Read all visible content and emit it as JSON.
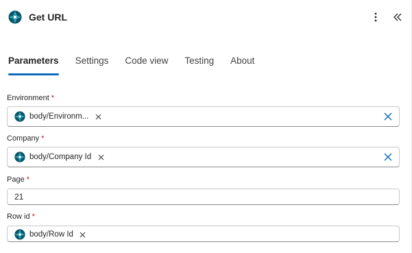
{
  "header": {
    "title": "Get URL",
    "logo_icon": "dataverse-logo-icon",
    "more_icon": "more-vertical-icon",
    "collapse_icon": "double-chevron-left-icon"
  },
  "tabs": [
    {
      "label": "Parameters",
      "active": true
    },
    {
      "label": "Settings",
      "active": false
    },
    {
      "label": "Code view",
      "active": false
    },
    {
      "label": "Testing",
      "active": false
    },
    {
      "label": "About",
      "active": false
    }
  ],
  "fields": {
    "environment": {
      "label": "Environment",
      "required_mark": "*",
      "token_label": "body/Environm...",
      "token_icon": "dataverse-logo-icon"
    },
    "company": {
      "label": "Company",
      "required_mark": "*",
      "token_label": "body/Company Id",
      "token_icon": "dataverse-logo-icon"
    },
    "page": {
      "label": "Page",
      "required_mark": "*",
      "value": "21"
    },
    "row_id": {
      "label": "Row id",
      "required_mark": "*",
      "token_label": "body/Row Id",
      "token_icon": "dataverse-logo-icon"
    }
  },
  "colors": {
    "accent": "#0f6cbd",
    "required": "#c50f1f",
    "logo_dark": "#0b556a",
    "logo_light": "#41c1d2"
  }
}
